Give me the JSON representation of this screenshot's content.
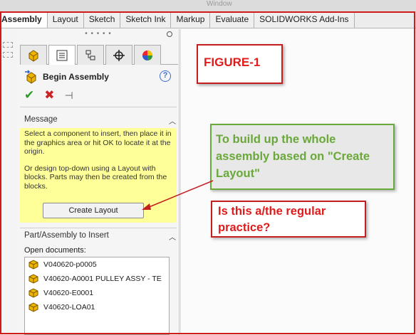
{
  "window": {
    "title": "Window"
  },
  "tabs": [
    {
      "label": "Assembly",
      "active": true
    },
    {
      "label": "Layout"
    },
    {
      "label": "Sketch"
    },
    {
      "label": "Sketch Ink"
    },
    {
      "label": "Markup"
    },
    {
      "label": "Evaluate"
    },
    {
      "label": "SOLIDWORKS Add-Ins"
    }
  ],
  "property_manager": {
    "title": "Begin Assembly",
    "help_label": "?",
    "icon_tabs": [
      "feature-manager-icon",
      "property-manager-icon",
      "configuration-manager-icon",
      "dimxpert-icon",
      "display-manager-icon"
    ],
    "actions": {
      "ok": "✔",
      "cancel": "✖",
      "pin": "⊣"
    },
    "message": {
      "heading": "Message",
      "paragraph1": "Select a component to insert, then place it in the graphics area or hit OK to locate it at the origin.",
      "paragraph2": "Or design top-down using a Layout with blocks. Parts may then be created from the blocks.",
      "button": "Create Layout"
    },
    "insert": {
      "heading": "Part/Assembly to Insert",
      "open_docs_label": "Open documents:",
      "documents": [
        "V040620-p0005",
        "V40620-A0001 PULLEY ASSY - TE",
        "V40620-E0001",
        "V40620-LOA01"
      ]
    }
  },
  "annotations": {
    "figure": "FIGURE-1",
    "green_callout": "To build up the whole assembly based on \"Create Layout\"",
    "red_callout": "Is this a/the regular practice?"
  },
  "colors": {
    "annotation_red": "#e01b1b",
    "annotation_green": "#6aa83a",
    "message_bg": "#ffff99"
  }
}
